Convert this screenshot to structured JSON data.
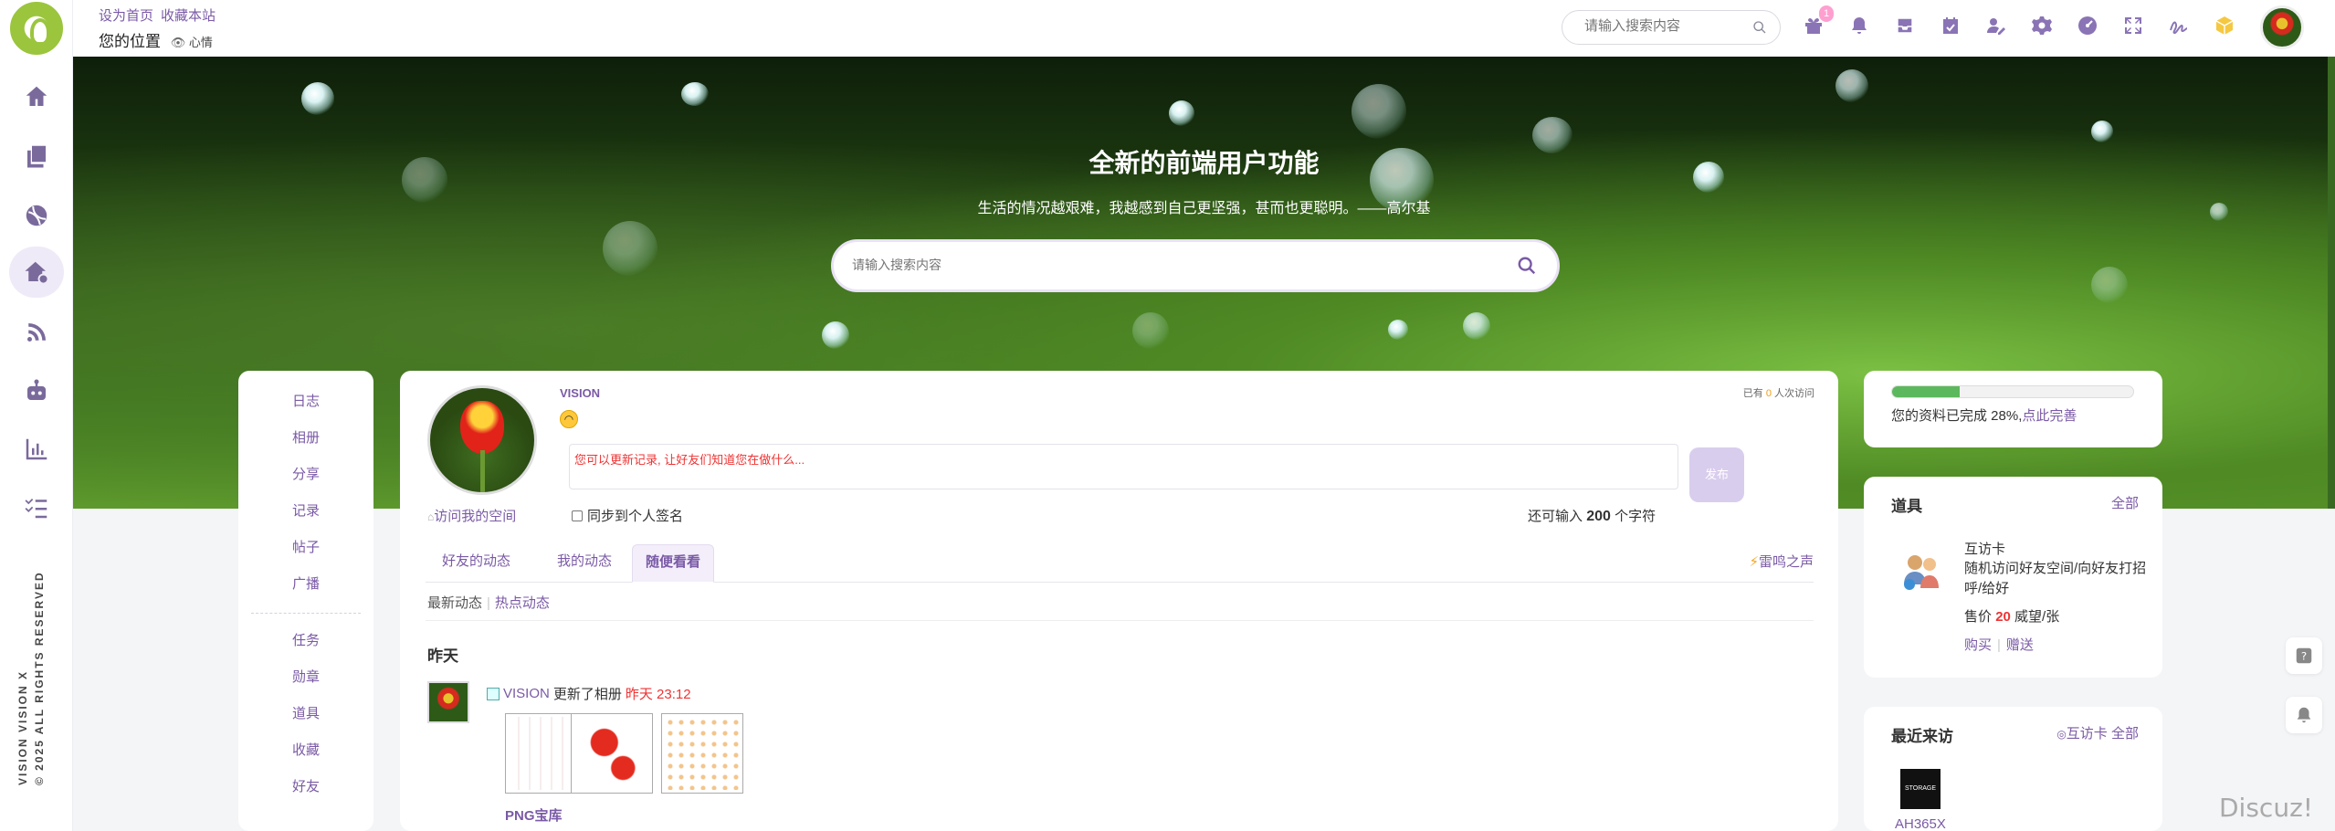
{
  "sidebar": {
    "items": [
      {
        "name": "home-icon"
      },
      {
        "name": "pages-icon"
      },
      {
        "name": "community-icon"
      },
      {
        "name": "home-space-icon",
        "active": true
      },
      {
        "name": "feed-icon"
      },
      {
        "name": "robot-icon"
      },
      {
        "name": "stats-icon"
      },
      {
        "name": "tasks-icon"
      }
    ],
    "copyright_line1": "VISION VISION X",
    "copyright_line2": "© 2025 ALL RIGHTS RESERVED"
  },
  "header": {
    "set_home": "设为首页",
    "bookmark": "收藏本站",
    "location_label": "您的位置",
    "location_sub": "心情",
    "search_placeholder": "请输入搜索内容",
    "notification_count": "1",
    "icons": [
      "gift-icon",
      "bell-icon",
      "inbox-icon",
      "calendar-icon",
      "user-edit-icon",
      "gear-icon",
      "dashboard-icon",
      "fullscreen-icon",
      "sign-icon",
      "cube-icon"
    ]
  },
  "banner": {
    "title": "全新的前端用户功能",
    "subtitle": "生活的情况越艰难，我越感到自己更坚强，甚而也更聪明。——高尔基",
    "search_placeholder": "请输入搜索内容"
  },
  "menu": {
    "group1": [
      "日志",
      "相册",
      "分享",
      "记录",
      "帖子",
      "广播"
    ],
    "group2": [
      "任务",
      "勋章",
      "道具",
      "收藏",
      "好友"
    ]
  },
  "profile": {
    "username": "VISION",
    "visit_space": "访问我的空间",
    "visits_prefix": "已有",
    "visits_count": "0",
    "visits_suffix": "人次访问",
    "status_placeholder": "您可以更新记录, 让好友们知道您在做什么...",
    "publish": "发布",
    "sync_label": "同步到个人签名",
    "remain_prefix": "还可输入",
    "remain_count": "200",
    "remain_suffix": "个字符"
  },
  "tabs": {
    "items": [
      "好友的动态",
      "我的动态",
      "随便看看"
    ],
    "active_index": 2,
    "thunder": "雷鸣之声"
  },
  "subtabs": {
    "latest": "最新动态",
    "hot": "热点动态"
  },
  "feed": {
    "day": "昨天",
    "user": "VISION",
    "action": "更新了相册",
    "time": "昨天 23:12",
    "album_name": "PNG宝库"
  },
  "profile_progress": {
    "percent": 28,
    "text": "您的资料已完成 28%,",
    "link": "点此完善"
  },
  "tools": {
    "title": "道具",
    "all": "全部",
    "item_name": "互访卡",
    "item_desc": "随机访问好友空间/向好友打招呼/给好",
    "price_prefix": "售价",
    "price_value": "20",
    "price_suffix": "威望/张",
    "buy": "购买",
    "gift": "赠送"
  },
  "recent": {
    "title": "最近来访",
    "card_link": "互访卡",
    "all": "全部",
    "visitor_name": "AH365X",
    "visitor_avatar_text": "STORAGE"
  },
  "watermark": "Discuz!"
}
